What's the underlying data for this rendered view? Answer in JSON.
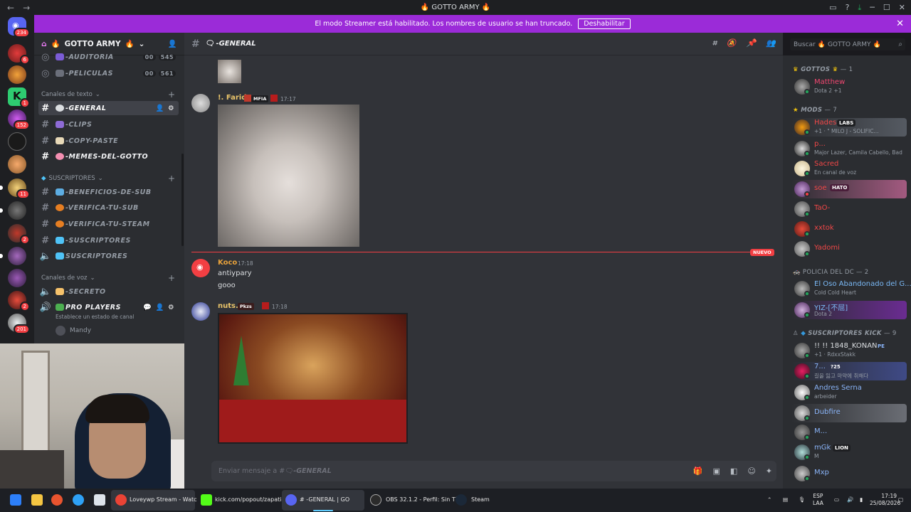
{
  "window": {
    "title": "GOTTO ARMY",
    "back": "←",
    "forward": "→"
  },
  "banner": {
    "text": "El modo Streamer está habilitado. Los nombres de usuario se han truncado.",
    "button": "Deshabilitar"
  },
  "guilds": {
    "dm_badge": "234",
    "badges": [
      "6",
      "1",
      "152",
      "11",
      "2",
      "2",
      "2",
      "201"
    ]
  },
  "server": {
    "name": "GOTTO ARMY"
  },
  "channels": {
    "top": [
      {
        "name": "-AUDITORIA",
        "count1": "00",
        "count2": "545"
      },
      {
        "name": "-PELICULAS",
        "count1": "00",
        "count2": "561"
      }
    ],
    "text_category": "Canales de texto",
    "text_channels": [
      {
        "name": "-GENERAL",
        "icon": "speech-bubble-icon"
      },
      {
        "name": "-CLIPS",
        "icon": "clip-icon"
      },
      {
        "name": "-COPY-PASTE",
        "icon": "page-icon"
      },
      {
        "name": "-MEMES-DEL-GOTTO",
        "icon": "pig-icon"
      }
    ],
    "sub_category": "SUSCRIPTORES",
    "sub_channels": [
      {
        "name": "-BENEFICIOS-DE-SUB",
        "icon": "laptop-icon"
      },
      {
        "name": "-VERIFICA-TU-SUB",
        "icon": "medal-icon"
      },
      {
        "name": "-VERIFICA-TU-STEAM",
        "icon": "medal-icon"
      },
      {
        "name": "-SUSCRIPTORES",
        "icon": "gem-icon"
      },
      {
        "name": "SUSCRIPTORES",
        "icon": "gem-icon"
      }
    ],
    "voice_category": "Canales de voz",
    "voice_channels": [
      {
        "name": "-SECRETO",
        "icon": "pray-icon"
      },
      {
        "name": "PRO PLAYERS",
        "icon": "shield-icon",
        "status": "Establece un estado de canal"
      }
    ],
    "voice_user": "Mandy"
  },
  "chat": {
    "channel": "-GENERAL",
    "placeholder": "Enviar mensaje a #",
    "placeholder_channel": "-GENERAL",
    "new_label": "NUEVO",
    "messages": [
      {
        "user": "!. Farid",
        "tag": "MFIA",
        "time": "17:17",
        "color": "#e9c46a"
      },
      {
        "user": "Koco",
        "time": "17:18",
        "color": "#e9a23b",
        "lines": [
          "antiypary",
          "gooo"
        ]
      },
      {
        "user": "nuts.",
        "tag": "Pkzs",
        "time": "17:18",
        "color": "#e9c46a"
      }
    ]
  },
  "search": {
    "placeholder": "Buscar",
    "scope": "GOTTO ARMY"
  },
  "members": {
    "groups": [
      {
        "name": "GOTTOS",
        "count": "— 1"
      },
      {
        "name": "MODS",
        "count": "— 7"
      },
      {
        "name": "POLICIA DEL DC",
        "count": "— 2"
      },
      {
        "name": "SUSCRIPTORES KICK",
        "count": "— 9"
      }
    ],
    "gottos": [
      {
        "name": "Matthew",
        "status": "Dota 2 +1",
        "color": "#f04770"
      }
    ],
    "mods": [
      {
        "name": "Hades",
        "badge": "LABS",
        "status": "+1 · \" MILO J - SOLIFIC...",
        "color": "#f04747"
      },
      {
        "name": "p...",
        "status": "Major Lazer, Camila Cabello, Bad",
        "color": "#f04747"
      },
      {
        "name": "Sacred",
        "status": "En canal de voz",
        "color": "#f04747"
      },
      {
        "name": "soe",
        "badge": "HATO",
        "status": "",
        "color": "#f04747"
      },
      {
        "name": "TaO-",
        "status": "",
        "color": "#f04747"
      },
      {
        "name": "xxtok",
        "status": "",
        "color": "#f04747"
      },
      {
        "name": "Yadomi",
        "status": "",
        "color": "#f04747"
      }
    ],
    "policia": [
      {
        "name": "El Oso Abandonado del G...",
        "status": "Cold Cold Heart",
        "color": "#7ab8f5"
      },
      {
        "name": "YIZ-[不屈]",
        "status": "Dota 2",
        "color": "#7ab8f5"
      }
    ],
    "kick": [
      {
        "name": "!! !! 1848_KONAN",
        "badge": "PE",
        "status": "+1 · RdxxStakk",
        "color": "#dbdee1"
      },
      {
        "name": "7...",
        "badge": "?25",
        "status": "길을 잃고 마약에 취해다",
        "color": "#8ab4f8"
      },
      {
        "name": "Andres Serna",
        "status": "arbeider",
        "color": "#8ab4f8"
      },
      {
        "name": "Dubfire",
        "status": "",
        "color": "#8ab4f8"
      },
      {
        "name": "M...",
        "status": "",
        "color": "#8ab4f8"
      },
      {
        "name": "mGk",
        "badge": "LION",
        "status": "M",
        "color": "#8ab4f8"
      },
      {
        "name": "Mxp",
        "status": "",
        "color": "#8ab4f8"
      }
    ]
  },
  "taskbar": {
    "items": [
      {
        "label": "Loveywp Stream - Watc"
      },
      {
        "label": "kick.com/popout/zapati"
      },
      {
        "label": "# -GENERAL | GO"
      },
      {
        "label": "OBS 32.1.2 - Perfil: Sin Tí"
      },
      {
        "label": "Steam"
      }
    ],
    "lang1": "ESP",
    "lang2": "LAA",
    "time": "17:19",
    "date": "25/08/2026"
  }
}
